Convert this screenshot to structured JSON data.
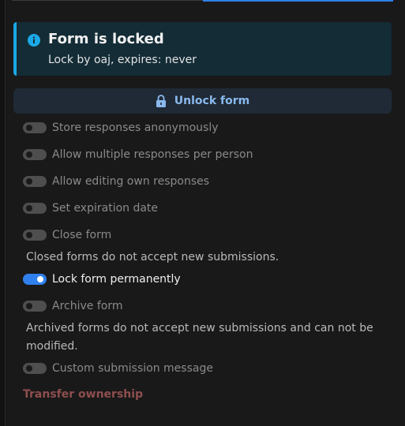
{
  "notice": {
    "title": "Form is locked",
    "text": "Lock by oaj, expires: never",
    "icon": "info-icon",
    "accent_color": "#1ba8e6"
  },
  "unlock_button": {
    "label": "Unlock form",
    "icon": "lock-icon"
  },
  "options": {
    "anonymous": {
      "label": "Store responses anonymously",
      "enabled": false
    },
    "multiple": {
      "label": "Allow multiple responses per person",
      "enabled": false
    },
    "editing": {
      "label": "Allow editing own responses",
      "enabled": false
    },
    "expiration": {
      "label": "Set expiration date",
      "enabled": false
    },
    "close": {
      "label": "Close form",
      "enabled": false,
      "hint": "Closed forms do not accept new submissions."
    },
    "lock": {
      "label": "Lock form permanently",
      "enabled": true
    },
    "archive": {
      "label": "Archive form",
      "enabled": false,
      "hint": "Archived forms do not accept new submissions and can not be modified."
    },
    "custom_message": {
      "label": "Custom submission message",
      "enabled": false
    }
  },
  "transfer_link": {
    "label": "Transfer ownership"
  },
  "colors": {
    "toggle_on": "#2f80ed",
    "toggle_off": "#4e4e4e",
    "danger_text": "#8f4e4e",
    "active_tab": "#2f7fe8"
  }
}
